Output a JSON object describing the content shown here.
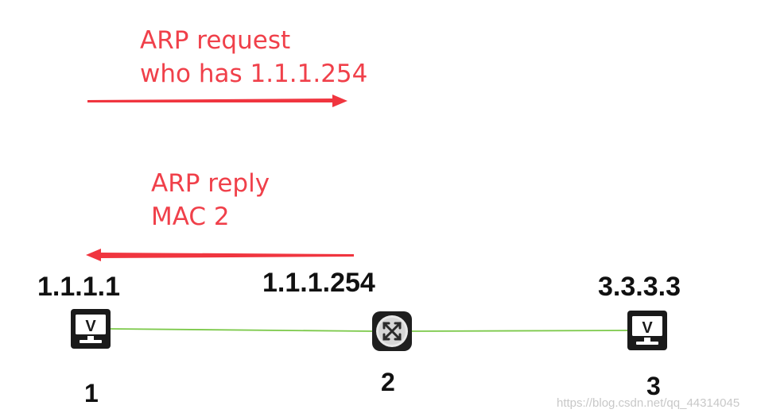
{
  "request": {
    "line1": "ARP request",
    "line2": "who has 1.1.1.254"
  },
  "reply": {
    "line1": "ARP reply",
    "line2": "MAC 2"
  },
  "nodes": [
    {
      "ip": "1.1.1.1",
      "id": "1",
      "icon": "pc-icon"
    },
    {
      "ip": "1.1.1.254",
      "id": "2",
      "icon": "router-icon"
    },
    {
      "ip": "3.3.3.3",
      "id": "3",
      "icon": "pc-icon"
    }
  ],
  "colors": {
    "arrow": "#f0353f",
    "text_red": "#f0404a",
    "link": "#7cc94a"
  },
  "watermark": "https://blog.csdn.net/qq_44314045"
}
